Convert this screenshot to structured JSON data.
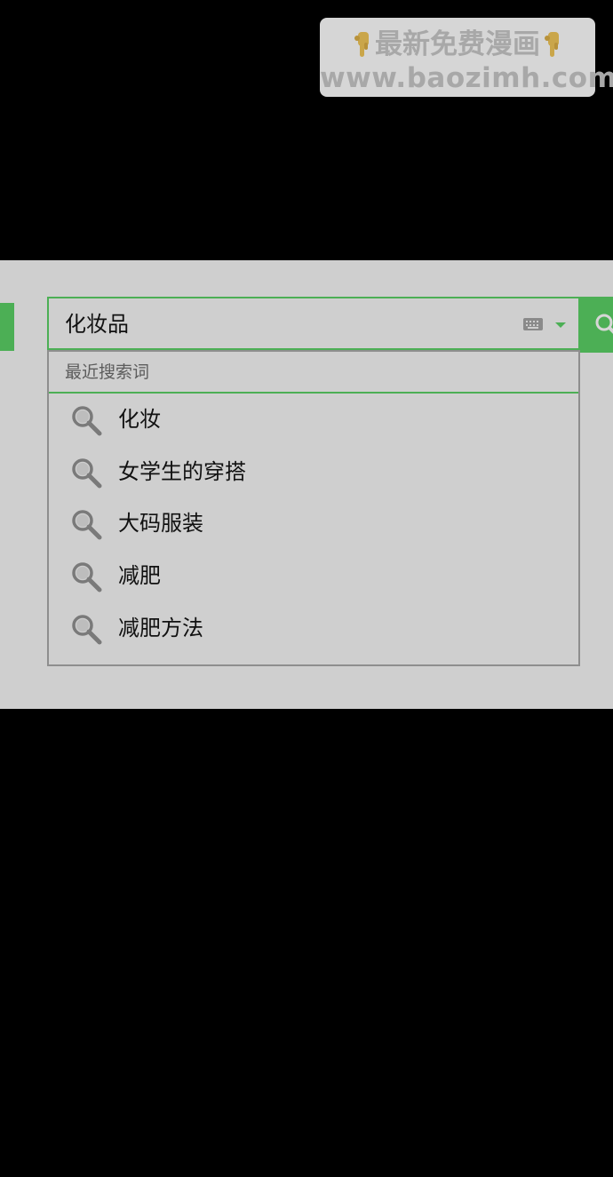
{
  "watermark": {
    "line1": "最新免费漫画",
    "line2": "www.baozimh.com",
    "hand_icon": "pointing-down-hand-icon"
  },
  "search": {
    "value": "化妆品",
    "keyboard_icon": "keyboard-icon",
    "dropdown_icon": "dropdown-arrow-icon",
    "button_icon": "search-icon",
    "accent_color": "#4caf55"
  },
  "suggestions": {
    "header": "最近搜索词",
    "items": [
      {
        "label": "化妆",
        "icon": "search-icon"
      },
      {
        "label": "女学生的穿搭",
        "icon": "search-icon"
      },
      {
        "label": "大码服装",
        "icon": "search-icon"
      },
      {
        "label": "减肥",
        "icon": "search-icon"
      },
      {
        "label": "减肥方法",
        "icon": "search-icon"
      }
    ]
  }
}
